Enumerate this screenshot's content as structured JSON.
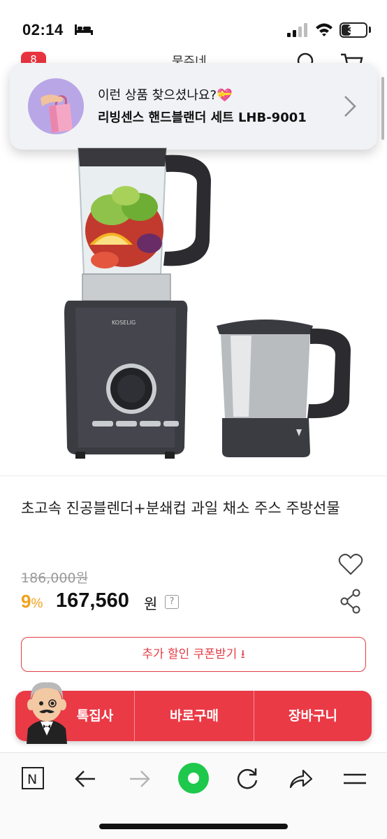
{
  "status": {
    "time": "02:14",
    "battery": "37",
    "battery_level": 0.37
  },
  "header": {
    "badge": "8",
    "title": "뭉쥬네"
  },
  "suggestion": {
    "line1": "이런 상품 찾으셨나요?💝",
    "line2": "리빙센스 핸드블랜더 세트 LHB-9001"
  },
  "product": {
    "title": "초고속 진공블렌더+분쇄컵 과일 채소 주스 주방선물",
    "original_price": "186,000원",
    "discount": "9",
    "discount_sign": "%",
    "sale_price": "167,560",
    "sale_unit": "원",
    "help": "?"
  },
  "coupon": {
    "label": "추가 할인 쿠폰받기 ⭳"
  },
  "buy_bar": {
    "special": "톡집사",
    "buy_now": "바로구매",
    "cart": "장바구니"
  },
  "colors": {
    "accent": "#ea3a46",
    "discount": "#f0a11b",
    "browser_green": "#1ec84c"
  },
  "toolbar": {
    "icons": [
      "naver-n-icon",
      "back-arrow-icon",
      "forward-arrow-icon",
      "green-home-icon",
      "reload-icon",
      "share-icon",
      "menu-icon"
    ],
    "n_label": "N"
  }
}
